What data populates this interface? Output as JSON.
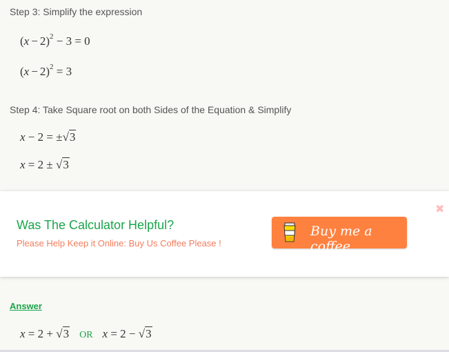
{
  "step3": {
    "title": "Step 3: Simplify the expression",
    "eq1": {
      "lhs_open": "(",
      "var": "x",
      "minus": "−",
      "num": "2",
      "close": ")",
      "exp": "2",
      "rest": "− 3 = 0"
    },
    "eq2": {
      "lhs_open": "(",
      "var": "x",
      "minus": "−",
      "num": "2",
      "close": ")",
      "exp": "2",
      "rest": "= 3"
    }
  },
  "step4": {
    "title": "Step 4: Take Square root on both Sides of the Equation & Simplify",
    "eq1": {
      "var": "x",
      "left": "− 2 = ±",
      "radicand": "3"
    },
    "eq2": {
      "var": "x",
      "left": "= 2 ±",
      "radicand": "3"
    }
  },
  "popup": {
    "title": "Was The Calculator Helpful?",
    "subtitle": "Please Help Keep it Online: Buy Us Coffee Please !",
    "button_label": "Buy me a coffee",
    "button_icon": "coffee-cup-icon",
    "close_icon": "close-icon",
    "colors": {
      "title": "#1aa54a",
      "subtitle": "#f47c5c",
      "button": "#ff813f",
      "close": "#ffbcbc"
    }
  },
  "answer": {
    "label": "Answer",
    "sol1": {
      "var": "x",
      "expr": "= 2 +",
      "radicand": "3"
    },
    "or": "OR",
    "sol2": {
      "var": "x",
      "expr": "= 2 −",
      "radicand": "3"
    }
  }
}
